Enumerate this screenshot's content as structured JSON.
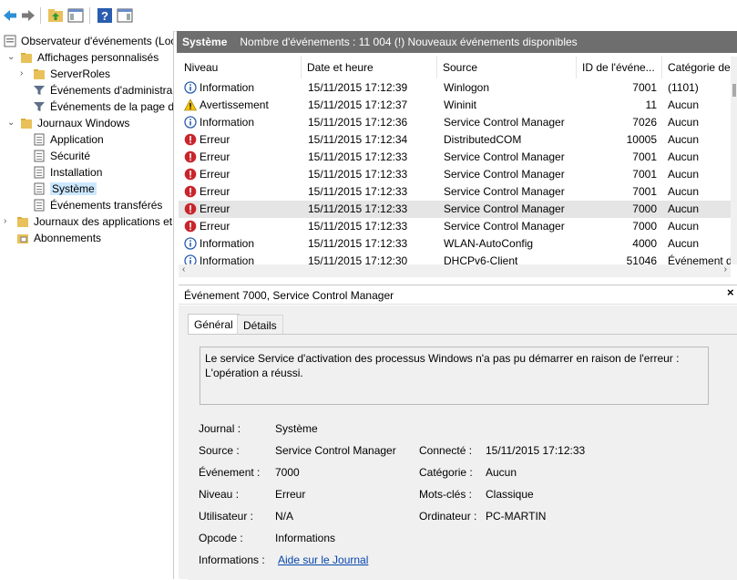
{
  "tree": {
    "root": "Observateur d'événements (Loc",
    "custom_views": "Affichages personnalisés",
    "server_roles": "ServerRoles",
    "admin_events": "Événements d'administra",
    "page_events": "Événements de la page d",
    "windows_logs": "Journaux Windows",
    "application": "Application",
    "security": "Sécurité",
    "setup": "Installation",
    "system": "Système",
    "forwarded": "Événements transférés",
    "app_logs": "Journaux des applications et",
    "subscriptions": "Abonnements"
  },
  "header": {
    "title": "Système",
    "summary": "Nombre d'événements : 11 004 (!) Nouveaux événements disponibles"
  },
  "columns": {
    "level": "Niveau",
    "date": "Date et heure",
    "source": "Source",
    "id": "ID de l'événe...",
    "category": "Catégorie de"
  },
  "events": [
    {
      "level": "Information",
      "type": "info",
      "date": "15/11/2015 17:12:39",
      "source": "Winlogon",
      "id": "7001",
      "category": "(1101)"
    },
    {
      "level": "Avertissement",
      "type": "warn",
      "date": "15/11/2015 17:12:37",
      "source": "Wininit",
      "id": "11",
      "category": "Aucun"
    },
    {
      "level": "Information",
      "type": "info",
      "date": "15/11/2015 17:12:36",
      "source": "Service Control Manager",
      "id": "7026",
      "category": "Aucun"
    },
    {
      "level": "Erreur",
      "type": "error",
      "date": "15/11/2015 17:12:34",
      "source": "DistributedCOM",
      "id": "10005",
      "category": "Aucun"
    },
    {
      "level": "Erreur",
      "type": "error",
      "date": "15/11/2015 17:12:33",
      "source": "Service Control Manager",
      "id": "7001",
      "category": "Aucun"
    },
    {
      "level": "Erreur",
      "type": "error",
      "date": "15/11/2015 17:12:33",
      "source": "Service Control Manager",
      "id": "7001",
      "category": "Aucun"
    },
    {
      "level": "Erreur",
      "type": "error",
      "date": "15/11/2015 17:12:33",
      "source": "Service Control Manager",
      "id": "7001",
      "category": "Aucun"
    },
    {
      "level": "Erreur",
      "type": "error",
      "date": "15/11/2015 17:12:33",
      "source": "Service Control Manager",
      "id": "7000",
      "category": "Aucun",
      "selected": true
    },
    {
      "level": "Erreur",
      "type": "error",
      "date": "15/11/2015 17:12:33",
      "source": "Service Control Manager",
      "id": "7000",
      "category": "Aucun"
    },
    {
      "level": "Information",
      "type": "info",
      "date": "15/11/2015 17:12:33",
      "source": "WLAN-AutoConfig",
      "id": "4000",
      "category": "Aucun"
    },
    {
      "level": "Information",
      "type": "info",
      "date": "15/11/2015 17:12:30",
      "source": "DHCPv6-Client",
      "id": "51046",
      "category": "Événement d'"
    }
  ],
  "detail": {
    "title": "Événement 7000, Service Control Manager",
    "tab_general": "Général",
    "tab_details": "Détails",
    "message": "Le service Service d'activation des processus Windows n'a pas pu démarrer en raison de l'erreur :\nL'opération a réussi.",
    "journal_label": "Journal :",
    "journal_value": "Système",
    "source_label": "Source :",
    "source_value": "Service Control Manager",
    "connected_label": "Connecté :",
    "connected_value": "15/11/2015 17:12:33",
    "event_label": "Événement :",
    "event_value": "7000",
    "category_label": "Catégorie :",
    "category_value": "Aucun",
    "level_label": "Niveau :",
    "level_value": "Erreur",
    "keywords_label": "Mots-clés :",
    "keywords_value": "Classique",
    "user_label": "Utilisateur :",
    "user_value": "N/A",
    "computer_label": "Ordinateur :",
    "computer_value": "PC-MARTIN",
    "opcode_label": "Opcode :",
    "opcode_value": "Informations",
    "info_label": "Informations :",
    "info_link": "Aide sur le Journal"
  },
  "colors": {
    "info": "#2a5db0",
    "warn": "#f5c400",
    "error": "#c9252c",
    "header_bg": "#6e6e6e",
    "selection": "#cce8ff"
  }
}
